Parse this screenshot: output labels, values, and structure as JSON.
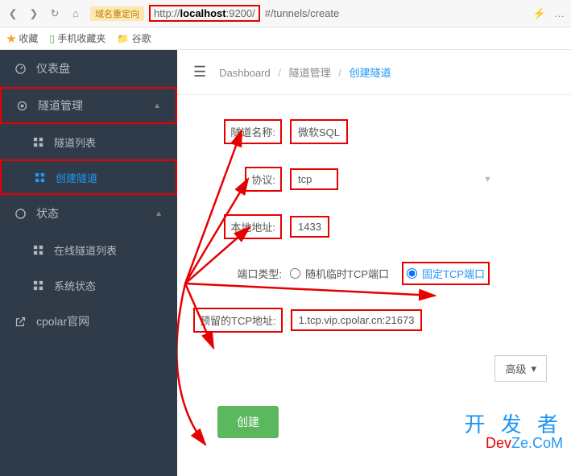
{
  "browser": {
    "domain_redirect_label": "域名重定向",
    "url_prefix": "http://",
    "url_host": "localhost",
    "url_port": ":9200/",
    "url_path": "#/tunnels/create"
  },
  "bookmarks": {
    "fav": "收藏",
    "mobile_fav": "手机收藏夹",
    "google": "谷歌"
  },
  "sidebar": {
    "dashboard": "仪表盘",
    "tunnel_mgmt": "隧道管理",
    "tunnel_list": "隧道列表",
    "create_tunnel": "创建隧道",
    "status": "状态",
    "online_tunnel_list": "在线隧道列表",
    "system_status": "系统状态",
    "cpolar": "cpolar官网"
  },
  "breadcrumb": {
    "dashboard": "Dashboard",
    "tunnel_mgmt": "隧道管理",
    "create_tunnel": "创建隧道"
  },
  "form": {
    "tunnel_name_label": "隧道名称:",
    "tunnel_name_value": "微软SQL",
    "protocol_label": "协议:",
    "protocol_value": "tcp",
    "local_addr_label": "本地地址:",
    "local_addr_value": "1433",
    "port_type_label": "端口类型:",
    "port_type_random": "随机临时TCP端口",
    "port_type_fixed": "固定TCP端口",
    "reserved_tcp_label": "预留的TCP地址:",
    "reserved_tcp_value": "1.tcp.vip.cpolar.cn:21673",
    "advanced_btn": "高级",
    "create_btn": "创建"
  },
  "watermark": {
    "line1": "开 发 者",
    "line2a": "Dev",
    "line2b": "Ze.CoM"
  }
}
